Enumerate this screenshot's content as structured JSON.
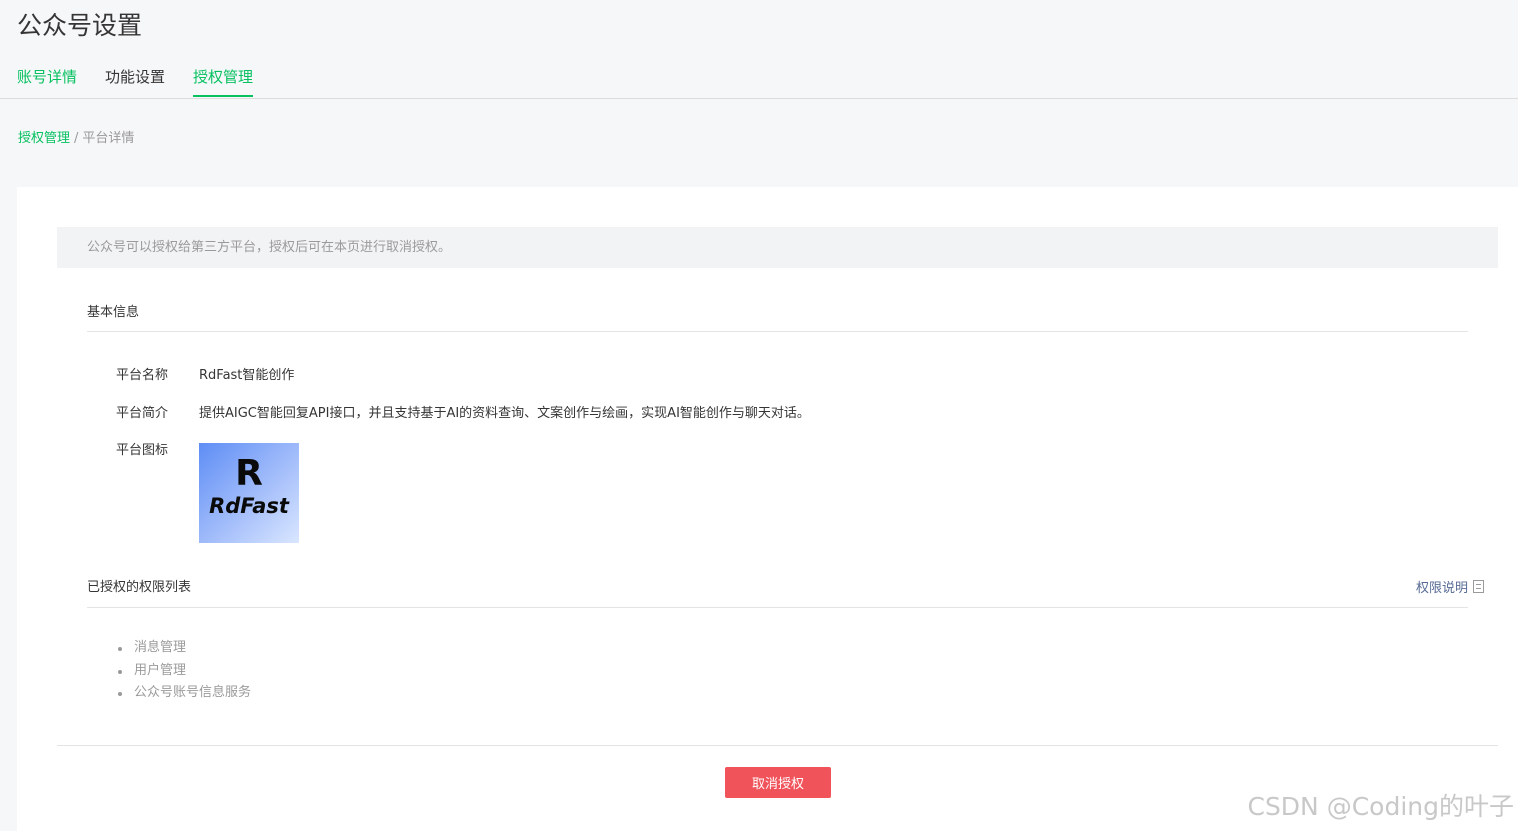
{
  "page_title": "公众号设置",
  "tabs": [
    {
      "label": "账号详情"
    },
    {
      "label": "功能设置"
    },
    {
      "label": "授权管理"
    }
  ],
  "breadcrumb": {
    "parent": "授权管理",
    "separator": "/",
    "current": "平台详情"
  },
  "notice": "公众号可以授权给第三方平台，授权后可在本页进行取消授权。",
  "basic_info": {
    "section_title": "基本信息",
    "name_label": "平台名称",
    "name_value": "RdFast智能创作",
    "desc_label": "平台简介",
    "desc_value": "提供AIGC智能回复API接口，并且支持基于AI的资料查询、文案创作与绘画，实现AI智能创作与聊天对话。",
    "icon_label": "平台图标",
    "logo": {
      "letter": "R",
      "wordmark": "RdFast"
    }
  },
  "permissions": {
    "section_title": "已授权的权限列表",
    "explain_link": "权限说明",
    "items": [
      "消息管理",
      "用户管理",
      "公众号账号信息服务"
    ]
  },
  "revoke_button": "取消授权",
  "watermark": "CSDN @Coding的叶子",
  "colors": {
    "accent": "#07c160",
    "danger": "#f0535a",
    "link": "#576b95"
  }
}
